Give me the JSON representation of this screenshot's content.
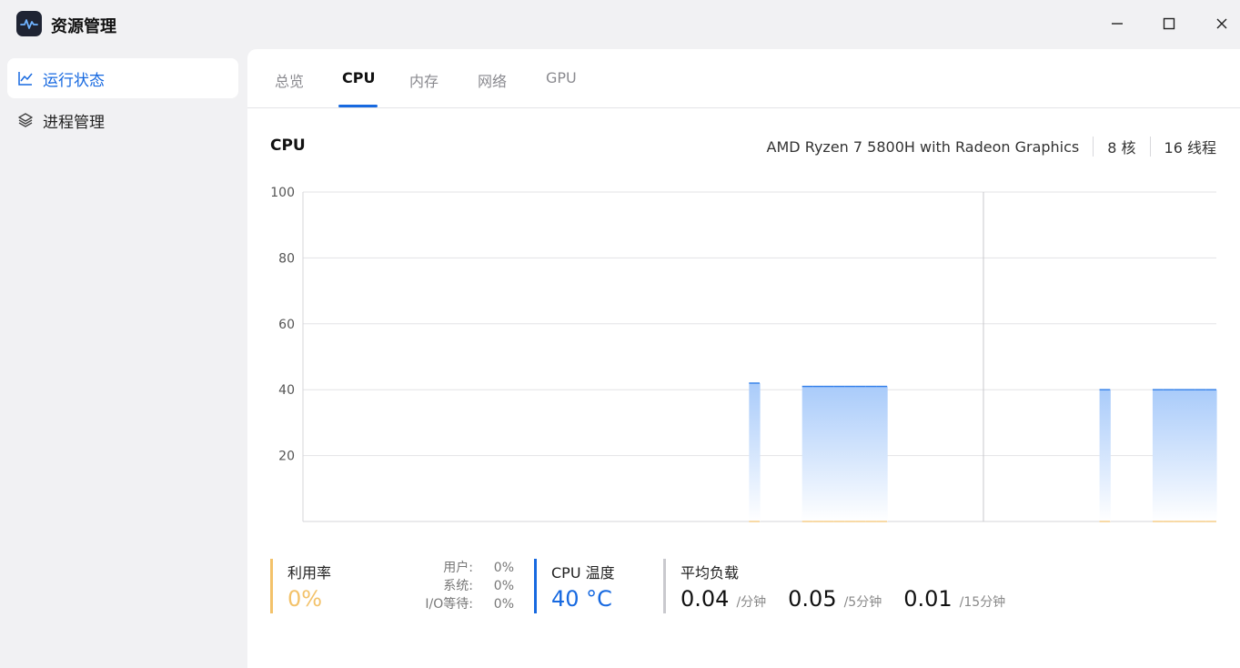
{
  "app": {
    "title": "资源管理"
  },
  "sidebar": {
    "items": [
      {
        "label": "运行状态",
        "icon": "line-chart-icon",
        "active": true
      },
      {
        "label": "进程管理",
        "icon": "layers-icon",
        "active": false
      }
    ]
  },
  "tabs": [
    {
      "label": "总览",
      "active": false
    },
    {
      "label": "CPU",
      "active": true
    },
    {
      "label": "内存",
      "active": false
    },
    {
      "label": "网络",
      "active": false
    },
    {
      "label": "GPU",
      "active": false
    }
  ],
  "cpu": {
    "section_title": "CPU",
    "model": "AMD Ryzen 7 5800H with Radeon Graphics",
    "cores": "8 核",
    "threads": "16 线程"
  },
  "chart_data": {
    "type": "area",
    "title": "",
    "xlabel": "",
    "ylabel": "",
    "ylim": [
      0,
      100
    ],
    "y_ticks": [
      "100",
      "80",
      "60",
      "40",
      "20"
    ],
    "grid": true,
    "series": [
      {
        "values": [
          0,
          0,
          0,
          0,
          0,
          0,
          0,
          0,
          0,
          0,
          0,
          0,
          0,
          0,
          0,
          0,
          0,
          0,
          0,
          0,
          0,
          0,
          0,
          0,
          0,
          0,
          0,
          0,
          0,
          0,
          0,
          0,
          0,
          0,
          0,
          0,
          0,
          0,
          0,
          0,
          0,
          0,
          42,
          0,
          0,
          0,
          0,
          41,
          41,
          41,
          41,
          41,
          41,
          41,
          41,
          0,
          0,
          0,
          0,
          0,
          0,
          0,
          0,
          0,
          0,
          0,
          0,
          0,
          0,
          0,
          0,
          0,
          0,
          0,
          0,
          40,
          0,
          0,
          0,
          0,
          40,
          40,
          40,
          40,
          40,
          40
        ]
      }
    ],
    "colors": {
      "line": "#2f7de9",
      "fill_top": "#a9cbfa",
      "fill_bottom": "#ffffff",
      "baseline": "#f3c26a"
    }
  },
  "stats": {
    "util": {
      "label": "利用率",
      "value": "0%",
      "user_label": "用户:",
      "user_value": "0%",
      "system_label": "系统:",
      "system_value": "0%",
      "io_label": "I/O等待:",
      "io_value": "0%"
    },
    "temp": {
      "label": "CPU 温度",
      "value": "40 °C"
    },
    "load": {
      "label": "平均负载",
      "v1": "0.04",
      "u1": "/分钟",
      "v5": "0.05",
      "u5": "/5分钟",
      "v15": "0.01",
      "u15": "/15分钟"
    }
  }
}
